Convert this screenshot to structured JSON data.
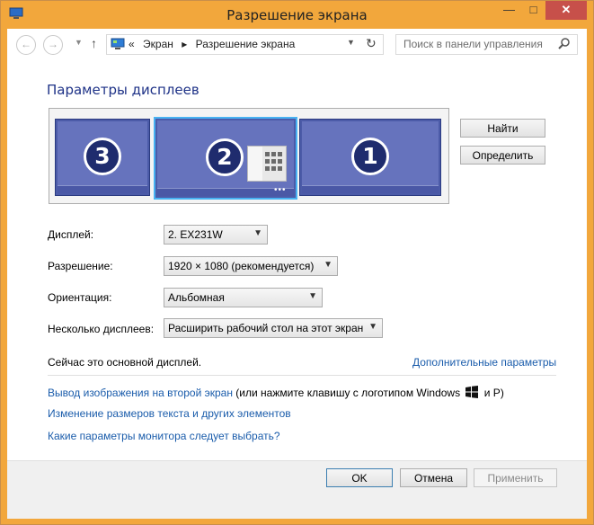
{
  "window": {
    "title": "Разрешение экрана",
    "min_glyph": "—",
    "max_glyph": "□",
    "close_glyph": "✕"
  },
  "nav": {
    "back_glyph": "←",
    "forward_glyph": "→",
    "up_glyph": "↑",
    "breadcrumb_prefix": "«",
    "breadcrumbs": [
      "Экран",
      "Разрешение экрана"
    ],
    "breadcrumb_separator": "▸",
    "search_placeholder": "Поиск в панели управления",
    "refresh_glyph": "↻"
  },
  "main": {
    "heading": "Параметры дисплеев",
    "monitors": [
      {
        "number": "3"
      },
      {
        "number": "2",
        "selected": true,
        "dots": "•••"
      },
      {
        "number": "1"
      }
    ],
    "find_button": "Найти",
    "identify_button": "Определить",
    "fields": {
      "display_label": "Дисплей:",
      "display_value": "2. EX231W",
      "resolution_label": "Разрешение:",
      "resolution_value": "1920 × 1080 (рекомендуется)",
      "orientation_label": "Ориентация:",
      "orientation_value": "Альбомная",
      "multi_label": "Несколько дисплеев:",
      "multi_value": "Расширить рабочий стол на этот экран"
    },
    "status": "Сейчас это основной дисплей.",
    "advanced_link": "Дополнительные параметры",
    "links": {
      "project_link": "Вывод изображения на второй экран",
      "project_suffix_a": " (или нажмите клавишу с логотипом Windows ",
      "project_suffix_b": " и P)",
      "resize_text_link": "Изменение размеров текста и других элементов",
      "which_settings_link": "Какие параметры монитора следует выбрать?"
    }
  },
  "footer": {
    "ok": "OK",
    "cancel": "Отмена",
    "apply": "Применить"
  },
  "colors": {
    "frame": "#f2a73c",
    "link": "#1a5cab",
    "heading": "#1e3287",
    "monitor": "#6673bd"
  }
}
